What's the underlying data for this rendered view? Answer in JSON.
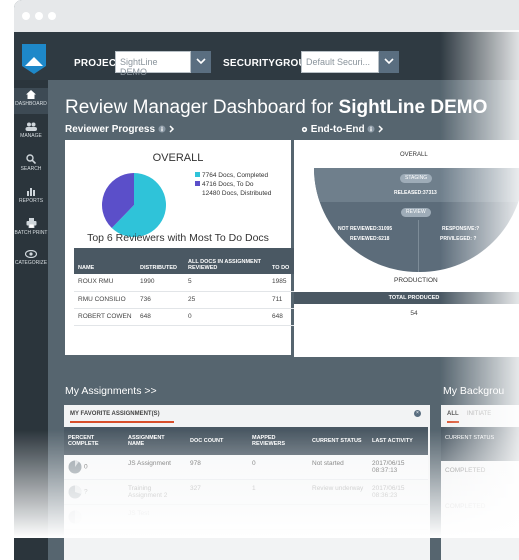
{
  "header": {
    "project_label": "PROJECT:",
    "project_value": "SightLine DEMO",
    "securitygroup_label": "SECURITYGROUP:",
    "securitygroup_value": "Default Securi..."
  },
  "sidebar": {
    "items": [
      {
        "label": "DASHBOARD",
        "icon": "home-icon"
      },
      {
        "label": "MANAGE",
        "icon": "users-icon"
      },
      {
        "label": "SEARCH",
        "icon": "search-icon"
      },
      {
        "label": "REPORTS",
        "icon": "bar-chart-icon"
      },
      {
        "label": "BATCH PRINT",
        "icon": "printer-icon"
      },
      {
        "label": "CATEGORIZE",
        "icon": "eye-icon"
      }
    ]
  },
  "page": {
    "title_prefix": "Review Manager Dashboard for ",
    "title_project": "SightLine DEMO"
  },
  "reviewer_progress": {
    "link": "Reviewer Progress",
    "overall": "OVERALL",
    "legend": [
      {
        "text": "7764 Docs, Completed",
        "color": "#2fc3d9"
      },
      {
        "text": "4716 Docs, To Do",
        "color": "#5b4fc9"
      },
      {
        "text": "12480 Docs, Distributed",
        "color": ""
      }
    ],
    "chart_data": {
      "type": "pie",
      "title": "OVERALL",
      "categories": [
        "Completed",
        "To Do"
      ],
      "values": [
        7764,
        4716
      ],
      "colors": [
        "#2fc3d9",
        "#5b4fc9"
      ],
      "total_distributed": 12480
    },
    "top6_title": "Top 6 Reviewers with Most To Do Docs",
    "columns": [
      "NAME",
      "DISTRIBUTED",
      "ALL DOCS IN ASSIGNMENT REVIEWED",
      "TO DO"
    ],
    "rows": [
      [
        "ROUX RMU",
        "1990",
        "5",
        "1985"
      ],
      [
        "RMU CONSILIO",
        "736",
        "25",
        "711"
      ],
      [
        "ROBERT COWEN",
        "648",
        "0",
        "648"
      ]
    ]
  },
  "end_to_end": {
    "link": "End-to-End",
    "overall": "OVERALL",
    "staging": "STAGING",
    "released": "RELEASED:37313",
    "review": "REVIEW",
    "not_reviewed": "NOT REVIEWED:31095",
    "reviewed": "REVIEWED:6218",
    "responsive": "RESPONSIVE:?",
    "privileged": "PRIVILEGED: ?",
    "production": "PRODUCTION",
    "total_produced_label": "TOTAL PRODUCED",
    "total_produced_value": "54"
  },
  "assignments": {
    "link": "My Assignments >>",
    "tab": "MY FAVORITE ASSIGNMENT(S)",
    "columns": [
      "PERCENT COMPLETE",
      "ASSIGNMENT NAME",
      "DOC COUNT",
      "MAPPED REVIEWERS",
      "CURRENT STATUS",
      "LAST ACTIVITY"
    ],
    "rows": [
      {
        "percent": "0",
        "name": "JS Assignment",
        "docs": "978",
        "reviewers": "0",
        "status": "Not started",
        "last": "2017/06/15 08:37:13",
        "pct": 0.1
      },
      {
        "percent": "?",
        "name": "Training Assignment 2",
        "docs": "327",
        "reviewers": "1",
        "status": "Review underway",
        "last": "2017/06/15 08:36:23",
        "pct": 0.3
      },
      {
        "percent": "",
        "name": "JS Test",
        "docs": "",
        "reviewers": "",
        "status": "",
        "last": "",
        "pct": 0.5
      }
    ]
  },
  "background": {
    "link": "My Backgrou",
    "tab_all": "ALL",
    "tab_initiated": "INITIATE",
    "col_status": "CURRENT STATUS",
    "row1": "COMPLETED",
    "row2": "COMPLETED"
  }
}
